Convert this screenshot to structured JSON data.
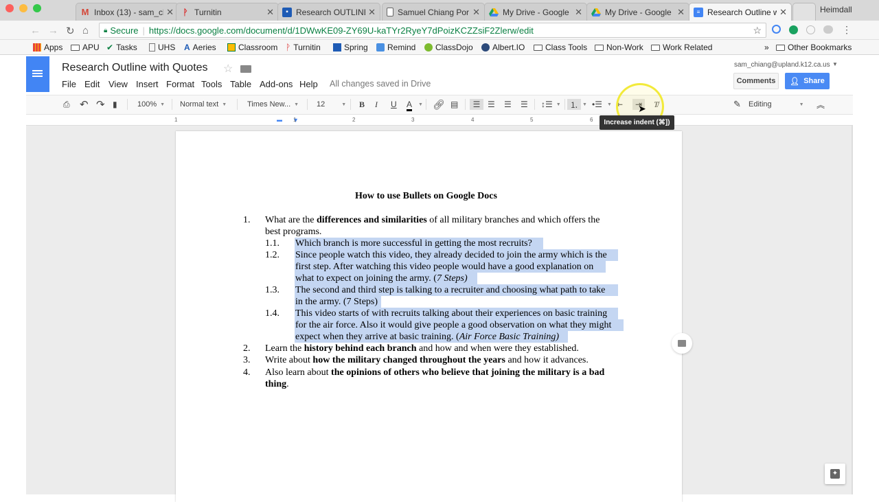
{
  "browser": {
    "tabs": [
      {
        "title": "Inbox (13) - sam_cl",
        "icon": "gmail-icon",
        "color": "#d44638",
        "active": false
      },
      {
        "title": "Turnitin",
        "icon": "turnitin-icon",
        "color": "#d92b2b",
        "active": false
      },
      {
        "title": "Research OUTLINE",
        "icon": "classroom-icon",
        "color": "#1e5bb5",
        "active": false
      },
      {
        "title": "Samuel Chiang Por",
        "icon": "file-icon",
        "color": "#666666",
        "active": false
      },
      {
        "title": "My Drive - Google",
        "icon": "drive-icon",
        "color": "#1aa260",
        "active": false
      },
      {
        "title": "My Drive - Google",
        "icon": "drive-icon",
        "color": "#1aa260",
        "active": false
      },
      {
        "title": "Research Outline w",
        "icon": "docs-icon",
        "color": "#4285f4",
        "active": true
      }
    ],
    "profile": "Heimdall",
    "secure_label": "Secure",
    "url": "https://docs.google.com/document/d/1DWwKE09-ZY69U-kaTYr2RyeY7dPoizKCZZsiF2Zlerw/edit",
    "bookmarks": [
      "Apps",
      "APU",
      "Tasks",
      "UHS",
      "Aeries",
      "Classroom",
      "Turnitin",
      "Spring",
      "Remind",
      "ClassDojo",
      "Albert.IO",
      "Class Tools",
      "Non-Work",
      "Work Related"
    ],
    "overflow": "»",
    "other_bookmarks": "Other Bookmarks"
  },
  "docs": {
    "title": "Research Outline with Quotes",
    "menu": [
      "File",
      "Edit",
      "View",
      "Insert",
      "Format",
      "Tools",
      "Table",
      "Add-ons",
      "Help"
    ],
    "save_status": "All changes saved in Drive",
    "user_email": "sam_chiang@upland.k12.ca.us",
    "comments_label": "Comments",
    "share_label": "Share",
    "zoom": "100%",
    "style": "Normal text",
    "font": "Times New...",
    "font_size": "12",
    "bold": "B",
    "italic": "I",
    "underline": "U",
    "text_color": "A",
    "mode": "Editing",
    "tooltip": "Increase indent (⌘])",
    "ruler_numbers": [
      "1",
      "1",
      "2",
      "3",
      "4",
      "5",
      "6"
    ],
    "accent": "#4285f4",
    "selection_color": "#c4d6f2"
  },
  "document": {
    "heading": "How to use Bullets on Google Docs",
    "num_1": "1.",
    "l1a_1": "What are the ",
    "l1a_2": "differences and similarities",
    "l1a_3": " of all military branches and which offers the",
    "l1b": "best programs.",
    "num_11": "1.1.",
    "l11": "Which branch is more successful in getting the most recruits?",
    "num_12": "1.2.",
    "l12a": "Since people watch this video, they already decided to join the army which is the",
    "l12b": "first step. After watching this video people would have a good explanation on",
    "l12c_1": "what to expect on joining the army. (",
    "l12c_2": "7 Steps)",
    "num_13": "1.3.",
    "l13a": "The second and third step is talking to a recruiter and choosing what path to take",
    "l13b": "in the army. (7 Steps)",
    "num_14": "1.4.",
    "l14a": "This video starts of with recruits talking about their experiences on basic training",
    "l14b": "for the air force. Also it would give people a good observation on what they might",
    "l14c_1": "expect when they arrive at basic training. (",
    "l14c_2": "Air Force Basic Training)",
    "num_2": "2.",
    "l2_1": "Learn the ",
    "l2_2": "history behind each branch",
    "l2_3": " and how and when were they established.",
    "num_3": "3.",
    "l3_1": "Write about ",
    "l3_2": "how the military changed throughout the years",
    "l3_3": " and how it advances.",
    "num_4": "4.",
    "l4a_1": "Also learn about ",
    "l4a_2": "the opinions of others who believe that joining the military is a bad",
    "l4b_1": "thing",
    "l4b_2": "."
  }
}
